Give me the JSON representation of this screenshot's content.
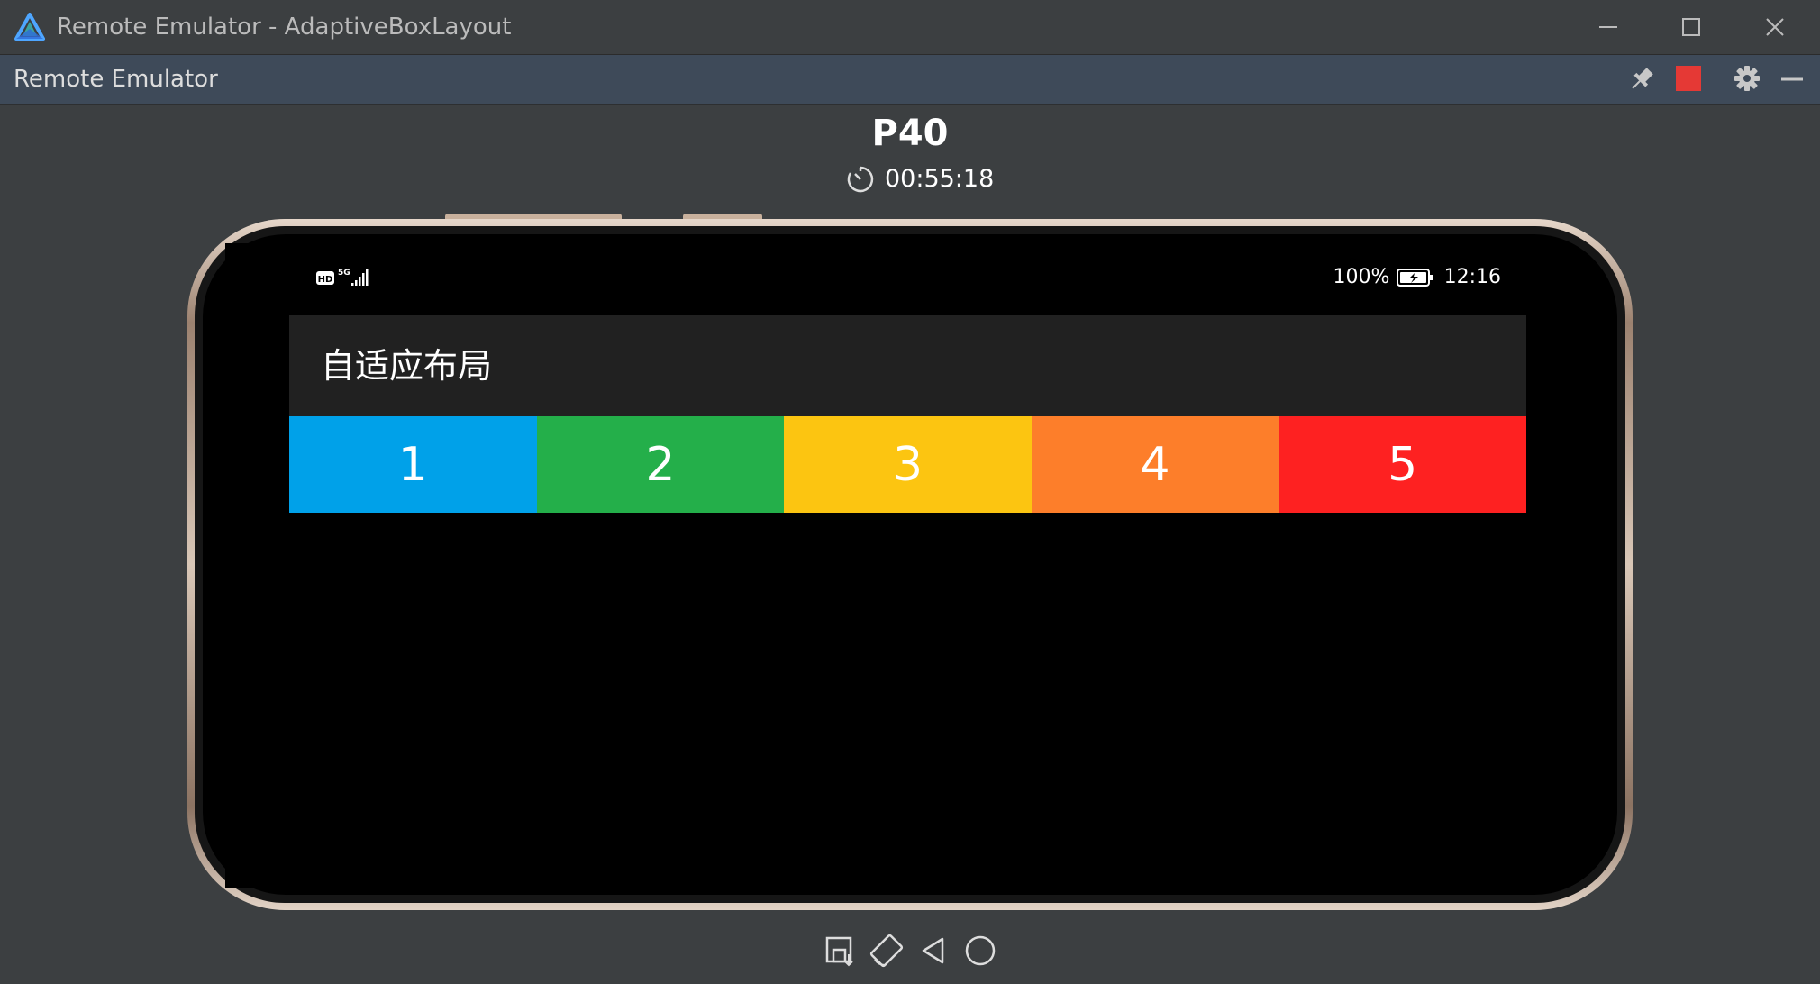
{
  "window": {
    "title": "Remote Emulator - AdaptiveBoxLayout",
    "logo_icon": "harmony-ide-logo-icon",
    "controls": [
      "minimize-icon",
      "maximize-icon",
      "close-icon"
    ]
  },
  "tool_window": {
    "title": "Remote Emulator",
    "actions": [
      "pin-icon",
      "stop-icon",
      "settings-icon",
      "hide-icon"
    ],
    "stop_color": "#e53935"
  },
  "emulator": {
    "device_name": "P40",
    "timer_icon": "timer-icon",
    "remaining_time": "00:55:18"
  },
  "status_bar": {
    "left_icons": [
      "hd-icon",
      "5g-signal-icon"
    ],
    "battery": "100%",
    "battery_icon": "battery-charging-icon",
    "time": "12:16"
  },
  "app": {
    "title": "自适应布局",
    "boxes": [
      {
        "label": "1",
        "color": "#00a1e9"
      },
      {
        "label": "2",
        "color": "#24af4a"
      },
      {
        "label": "3",
        "color": "#fcc511"
      },
      {
        "label": "4",
        "color": "#fd7e2a"
      },
      {
        "label": "5",
        "color": "#fe2121"
      }
    ]
  },
  "nav_bar": [
    "recent-apps-icon",
    "home-icon",
    "back-icon"
  ],
  "bottom_toolbar": [
    "screenshot-icon",
    "rotate-icon",
    "back-icon",
    "home-icon"
  ]
}
